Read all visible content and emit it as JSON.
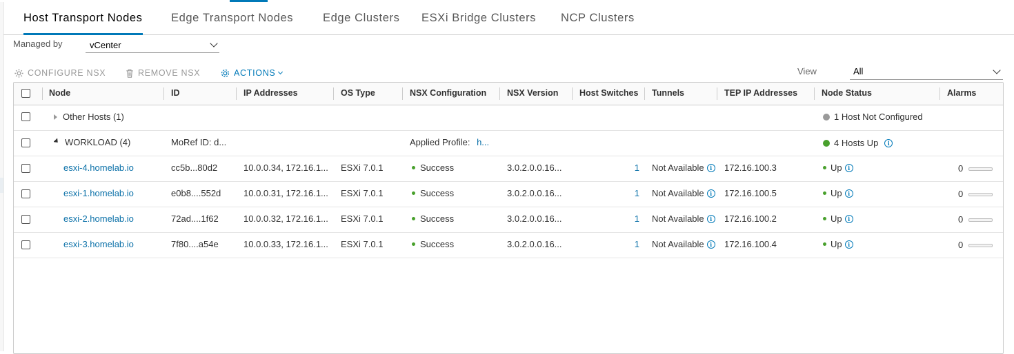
{
  "tabs": [
    {
      "label": "Host Transport Nodes",
      "active": true
    },
    {
      "label": "Edge Transport Nodes",
      "active": false
    },
    {
      "label": "Edge Clusters",
      "active": false
    },
    {
      "label": "ESXi Bridge Clusters",
      "active": false
    },
    {
      "label": "NCP Clusters",
      "active": false
    }
  ],
  "filter": {
    "managed_by_label": "Managed by",
    "managed_by_value": "vCenter"
  },
  "toolbar": {
    "configure": "CONFIGURE NSX",
    "remove": "REMOVE NSX",
    "actions": "ACTIONS"
  },
  "view": {
    "label": "View",
    "value": "All"
  },
  "columns": [
    "Node",
    "ID",
    "IP Addresses",
    "OS Type",
    "NSX Configuration",
    "NSX Version",
    "Host Switches",
    "Tunnels",
    "TEP IP Addresses",
    "Node Status",
    "Alarms"
  ],
  "groups": {
    "other": {
      "name": "Other Hosts (1)",
      "status": "1 Host Not Configured"
    },
    "workload": {
      "name": "WORKLOAD (4)",
      "id": "MoRef ID: d...",
      "profile_label": "Applied Profile:",
      "profile_value": "h...",
      "status": "4 Hosts Up"
    }
  },
  "hosts": [
    {
      "node": "esxi-4.homelab.io",
      "id": "cc5b...80d2",
      "ip": "10.0.0.34, 172.16.1...",
      "os": "ESXi 7.0.1",
      "config": "Success",
      "version": "3.0.2.0.0.16...",
      "switches": "1",
      "tunnels": "Not Available",
      "tep": "172.16.100.3",
      "status": "Up",
      "alarms": "0"
    },
    {
      "node": "esxi-1.homelab.io",
      "id": "e0b8....552d",
      "ip": "10.0.0.31, 172.16.1...",
      "os": "ESXi 7.0.1",
      "config": "Success",
      "version": "3.0.2.0.0.16...",
      "switches": "1",
      "tunnels": "Not Available",
      "tep": "172.16.100.5",
      "status": "Up",
      "alarms": "0"
    },
    {
      "node": "esxi-2.homelab.io",
      "id": "72ad....1f62",
      "ip": "10.0.0.32, 172.16.1...",
      "os": "ESXi 7.0.1",
      "config": "Success",
      "version": "3.0.2.0.0.16...",
      "switches": "1",
      "tunnels": "Not Available",
      "tep": "172.16.100.2",
      "status": "Up",
      "alarms": "0"
    },
    {
      "node": "esxi-3.homelab.io",
      "id": "7f80....a54e",
      "ip": "10.0.0.33, 172.16.1...",
      "os": "ESXi 7.0.1",
      "config": "Success",
      "version": "3.0.2.0.0.16...",
      "switches": "1",
      "tunnels": "Not Available",
      "tep": "172.16.100.4",
      "status": "Up",
      "alarms": "0"
    }
  ],
  "colors": {
    "accent": "#0079b8",
    "success": "#48a02c",
    "not_configured": "#9a9a9a"
  }
}
